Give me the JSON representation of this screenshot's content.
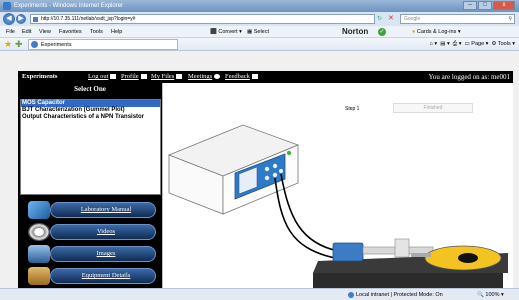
{
  "window": {
    "title": "Experiments - Windows Internet Explorer"
  },
  "addressbar": {
    "url": "http://10.7.35.111/netlab/vsdt_jsp?login=y#",
    "search_placeholder": "Google",
    "stop": "✕"
  },
  "menubar": {
    "items": [
      "File",
      "Edit",
      "View",
      "Favorites",
      "Tools",
      "Help"
    ],
    "convert": "Convert",
    "select": "Select",
    "norton": "Norton",
    "cards": "Cards & Log-ins"
  },
  "favorites": {
    "tab_label": "Experiments",
    "page": "Page",
    "tools": "Tools"
  },
  "nav": {
    "title": "Experiments",
    "logout": "Log out",
    "profile": "Profile",
    "myfiles": "My Files",
    "meetings": "Meetings",
    "feedback": "Feedback",
    "logged_on": "You are logged on as: me001"
  },
  "left": {
    "heading": "Select One",
    "experiments": [
      "MOS Capacitor",
      "BJT Characterization (Gummel Plot)",
      "Output Characteristics of a NPN Transistor"
    ],
    "buttons": [
      "Laboratory Manual",
      "Videos",
      "Images",
      "Equipment Details"
    ]
  },
  "right": {
    "step_label": "Step 1",
    "status": "Finished"
  },
  "status": {
    "zone": "Local intranet | Protected Mode: On",
    "zoom": "100%"
  }
}
